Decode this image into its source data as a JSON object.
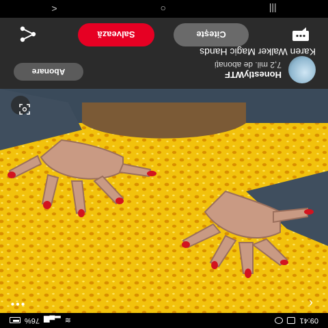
{
  "status_bar": {
    "time": "09:41",
    "battery": "76%"
  },
  "pin": {
    "title": "Karen Walker Magic Hands",
    "creator_name": "HonestlyWTF",
    "creator_subscribers": "7,2 mil. de abonați"
  },
  "buttons": {
    "follow": "Abonare",
    "read": "Citește",
    "save": "Salvează"
  },
  "colors": {
    "save_button": "#e60023",
    "panel": "#2b2b2b",
    "photo_background": "#e9b100"
  },
  "icons": [
    "back-icon",
    "more-icon",
    "visual-search-icon",
    "comment-icon",
    "share-icon"
  ],
  "nav": {
    "back": "<",
    "home": "○",
    "recents": "|||"
  }
}
